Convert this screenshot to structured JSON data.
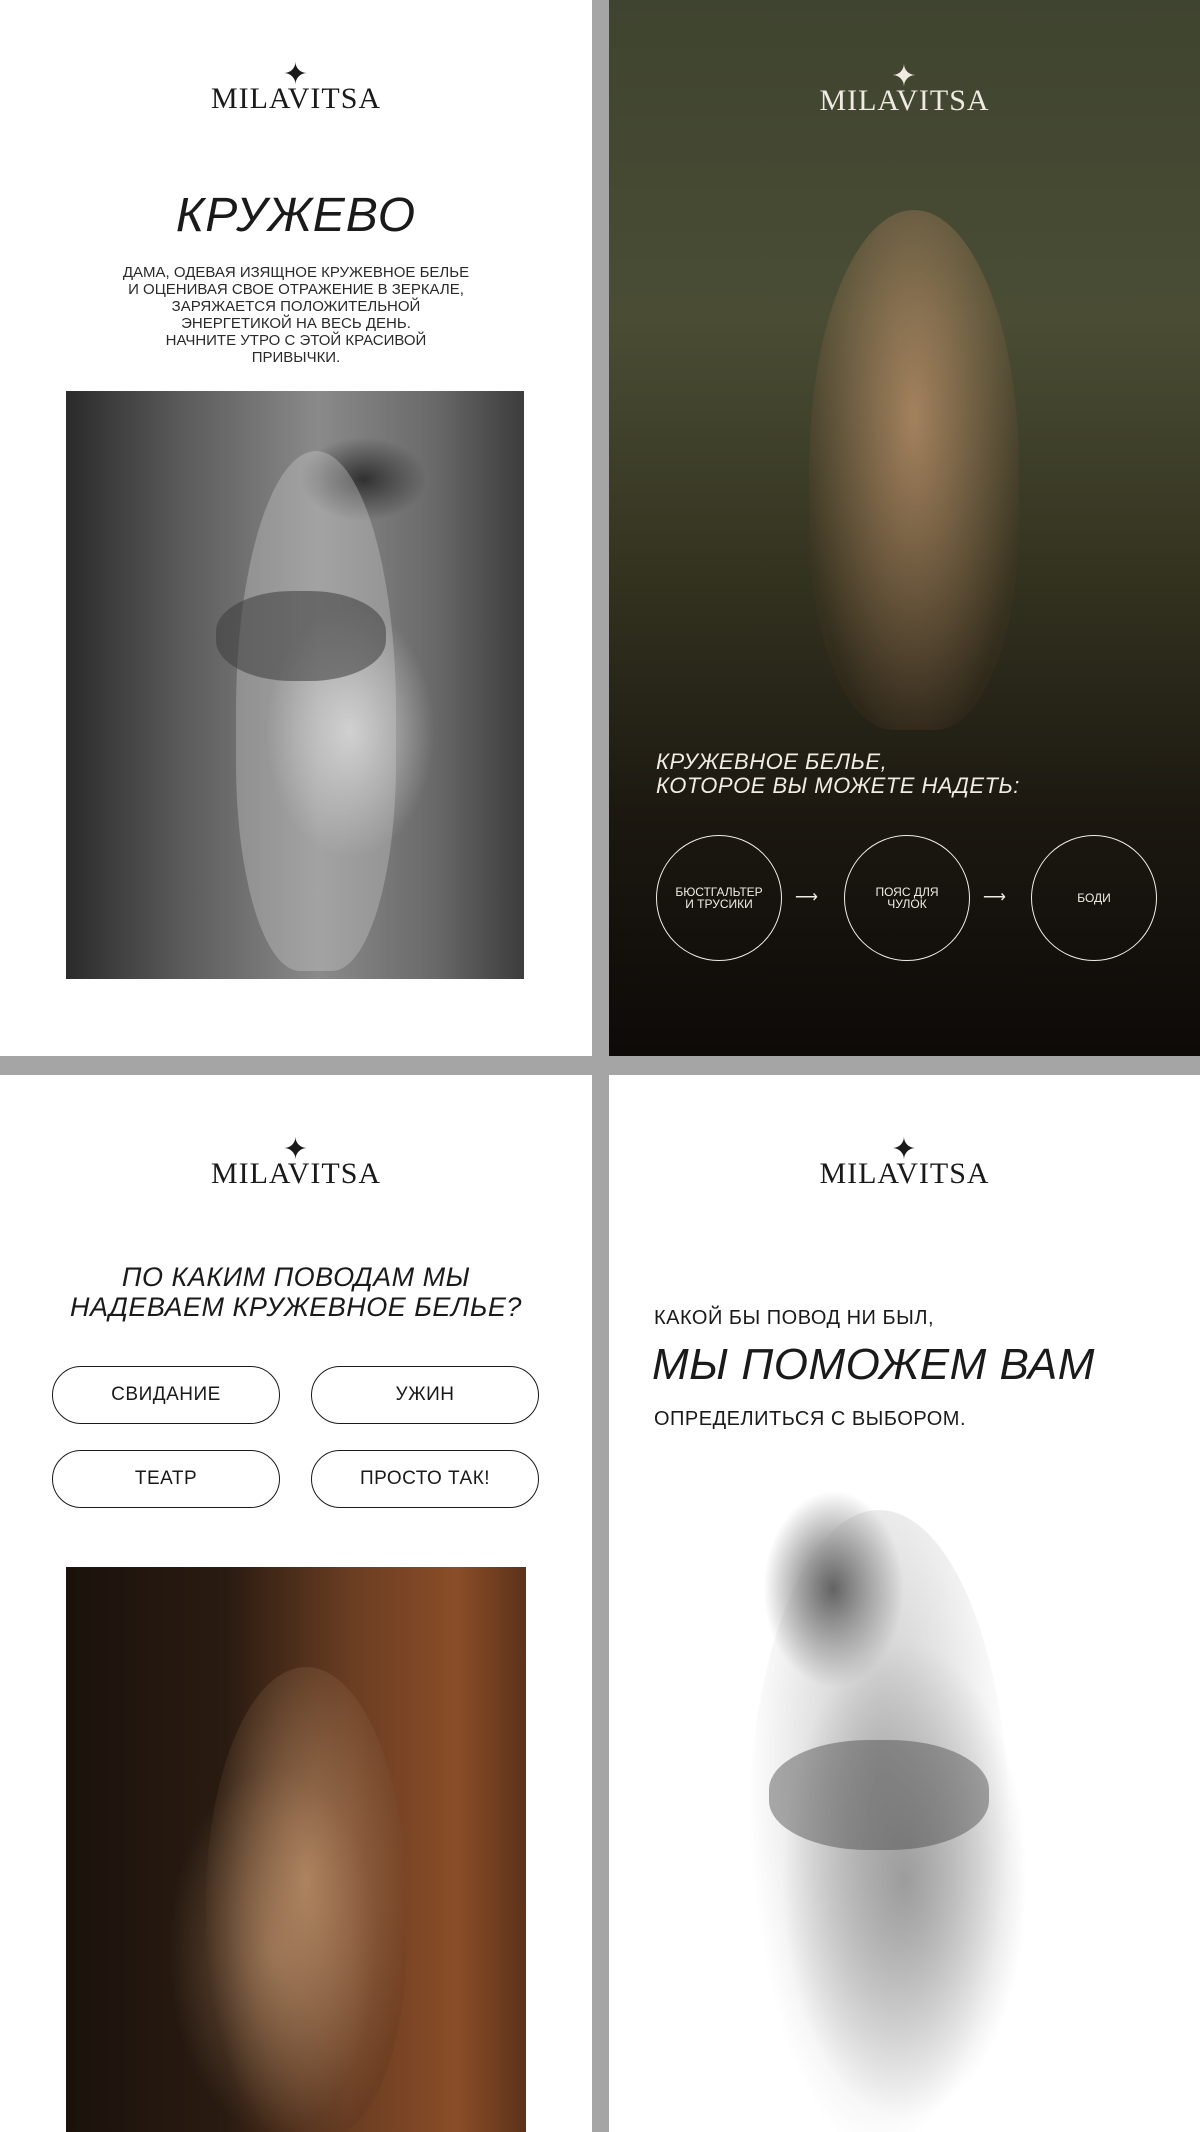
{
  "brand": {
    "logo_text": "MILAVITSA"
  },
  "panel1": {
    "title": "КРУЖЕВО",
    "lead_lines": [
      "ДАМА, ОДЕВАЯ ИЗЯЩНОЕ КРУЖЕВНОЕ БЕЛЬЕ",
      "И ОЦЕНИВАЯ СВОЕ ОТРАЖЕНИЕ В ЗЕРКАЛЕ,",
      "ЗАРЯЖАЕТСЯ ПОЛОЖИТЕЛЬНОЙ",
      "ЭНЕРГЕТИКОЙ НА ВЕСЬ ДЕНЬ.",
      "НАЧНИТЕ УТРО С ЭТОЙ КРАСИВОЙ",
      "ПРИВЫЧКИ."
    ]
  },
  "panel2": {
    "subtitle_line1": "КРУЖЕВНОЕ БЕЛЬЕ,",
    "subtitle_line2": "КОТОРОЕ ВЫ МОЖЕТЕ НАДЕТЬ:",
    "steps": [
      {
        "label_line1": "БЮСТГАЛЬТЕР",
        "label_line2": "И ТРУСИКИ"
      },
      {
        "label_line1": "ПОЯС ДЛЯ",
        "label_line2": "ЧУЛОК"
      },
      {
        "label_line1": "БОДИ",
        "label_line2": ""
      }
    ],
    "arrow_glyph": "⟶"
  },
  "panel3": {
    "question_line1": "ПО КАКИМ ПОВОДАМ МЫ",
    "question_line2": "НАДЕВАЕМ КРУЖЕВНОЕ БЕЛЬЕ?",
    "occasions": [
      "СВИДАНИЕ",
      "УЖИН",
      "ТЕАТР",
      "ПРОСТО ТАК!"
    ]
  },
  "panel4": {
    "line1": "КАКОЙ БЫ ПОВОД НИ БЫЛ,",
    "big": "МЫ ПОМОЖЕМ ВАМ",
    "line2": "ОПРЕДЕЛИТЬСЯ С ВЫБОРОМ."
  },
  "colors": {
    "ink": "#1a1a1a",
    "light_text": "#f1ece4",
    "separator": "#a5a5a5"
  },
  "icons": {
    "logo_star": "star-icon"
  }
}
